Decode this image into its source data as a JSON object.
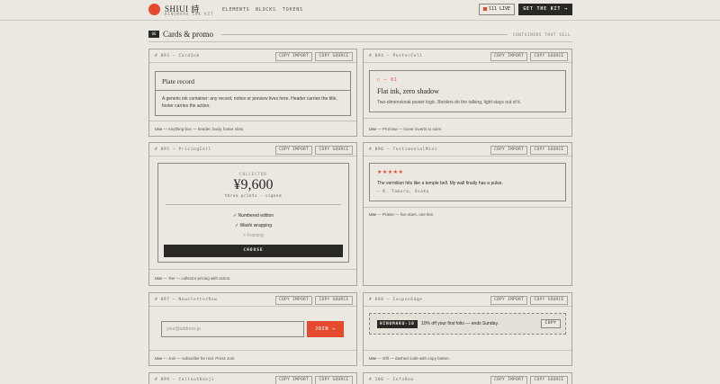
{
  "header": {
    "brand": "SHIUI 詩",
    "brand_sub": "HINOMARU INK KIT",
    "nav": [
      "ELEMENTS",
      "BLOCKS",
      "TOKENS"
    ],
    "live_label": "111 LIVE",
    "cta_label": "GET THE KIT →"
  },
  "section": {
    "number": "06",
    "title": "Cards & promo",
    "tag": "CONTAINERS THAT SELL"
  },
  "card_buttons": {
    "copy_import": "COPY IMPORT",
    "copy_source": "COPY SOURCE"
  },
  "cards": {
    "plate": {
      "id": "# 093 — CardInk",
      "title": "Plate record",
      "body": "A generic ink container: any record, notice or preview lives here. Header carries the title, footer carries the action.",
      "use_label": "Use",
      "use_text": "— Anything box — header, body, footer slots."
    },
    "poster": {
      "id": "# 094 — PosterCell",
      "kicker": "○ — 01",
      "title": "Flat ink, zero shadow",
      "sub": "Two-dimensional poster logic. Borders do the talking, light stays out of it.",
      "use_label": "Use",
      "use_text": "— Promise — hover inverts to sumi."
    },
    "pricing": {
      "id": "# 095 — PricingCell",
      "label": "COLLECTOR",
      "price": "¥9,600",
      "note": "three prints · signed",
      "features": [
        "✓ Numbered edition",
        "✓ Washi wrapping"
      ],
      "feature_dim": "× Framing",
      "choose": "CHOOSE",
      "use_label": "Use",
      "use_text": "— Tier — collector pricing with action."
    },
    "testimonial": {
      "id": "# 096 — TestimonialMini",
      "stars": "★★★★★",
      "quote": "The vermilion hits like a temple bell. My wall finally has a pulse.",
      "cite": "— K. Tamura, Osaka",
      "use_label": "Use",
      "use_text": "— Praise — five stars, one line."
    },
    "newsletter": {
      "id": "# 097 — NewsletterRow",
      "placeholder": "your@address.jp",
      "join": "JOIN →",
      "use_label": "Use",
      "use_text": "— Join — subscribe for real. Press Join."
    },
    "coupon": {
      "id": "# 098 — CouponEdge",
      "code": "HINOMARU-10",
      "text": "10% off your first folio — ends Sunday.",
      "copy": "COPY",
      "use_label": "Use",
      "use_text": "— Gift — dashed code with copy button."
    },
    "next_left": {
      "id": "# 099 — CalloutKanji"
    },
    "next_right": {
      "id": "# 100 — InfoRow"
    }
  },
  "colors": {
    "accent": "#e64a2e",
    "ink": "#2a2825",
    "paper": "#ebe8e2"
  }
}
